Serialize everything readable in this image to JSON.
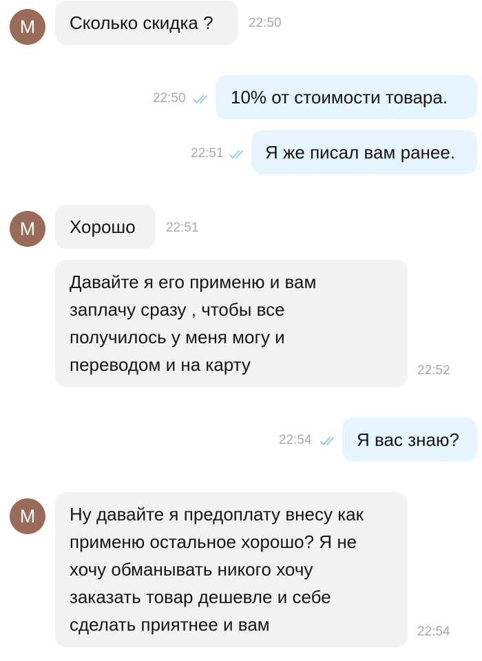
{
  "avatar_letter": "М",
  "colors": {
    "avatar": "#9a6b58",
    "incoming_bubble": "#f2f2f2",
    "outgoing_bubble": "#e5f4ff",
    "read_ticks": "#7cc3ef",
    "timestamp": "#a9a9a9"
  },
  "messages": [
    {
      "direction": "in",
      "text": "Сколько скидка ?",
      "time": "22:50"
    },
    {
      "direction": "out",
      "text": "10% от стоимости товара.",
      "time": "22:50",
      "status_icon": "double-check-icon"
    },
    {
      "direction": "out",
      "text": "Я же писал вам ранее.",
      "time": "22:51",
      "status_icon": "double-check-icon"
    },
    {
      "direction": "in",
      "text": "Хорошо",
      "time": "22:51"
    },
    {
      "direction": "in",
      "text": "Давайте я его применю и вам\nзаплачу сразу , чтобы все\nполучилось у меня могу и\nпереводом и на карту",
      "time": "22:52"
    },
    {
      "direction": "out",
      "text": "Я вас знаю?",
      "time": "22:54",
      "status_icon": "double-check-icon"
    },
    {
      "direction": "in",
      "text": "Ну давайте я предоплату внесу как\nприменю остальное хорошо? Я не\nхочу обманывать никого хочу\nзаказать товар дешевле и себе\nсделать приятнее и вам",
      "time": "22:54"
    }
  ]
}
